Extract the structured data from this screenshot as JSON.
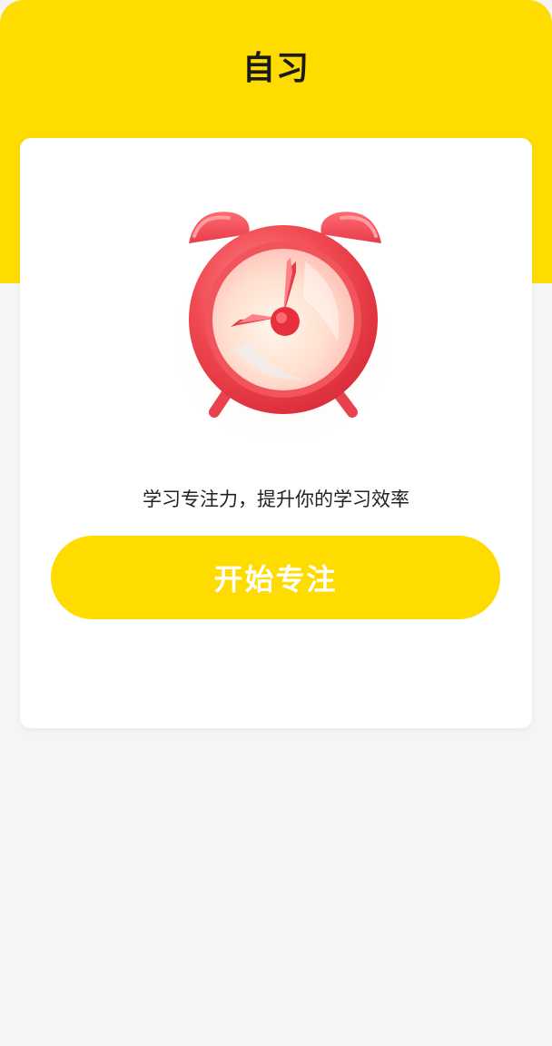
{
  "header": {
    "title": "自习"
  },
  "card": {
    "illustration_icon": "alarm-clock-icon",
    "tagline": "学习专注力，提升你的学习效率",
    "start_button_label": "开始专注"
  },
  "colors": {
    "header_background": "#ffdc00",
    "button_background": "#ffdc00",
    "button_text": "#ffffff",
    "page_background": "#f5f5f5",
    "clock_red": "#f0464d"
  }
}
